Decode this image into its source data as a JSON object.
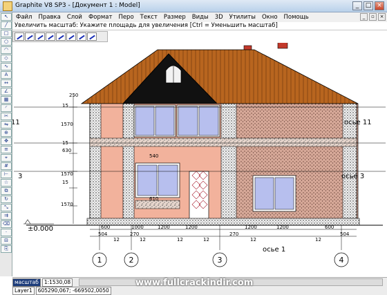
{
  "window": {
    "title": "Graphite V8 SP3 - [Документ 1 : Model]",
    "controls": [
      "_",
      "□",
      "×"
    ]
  },
  "menu": [
    "Файл",
    "Правка",
    "Слой",
    "Формат",
    "Перо",
    "Текст",
    "Размер",
    "Виды",
    "3D",
    "Утилиты",
    "Окно",
    "Помощь"
  ],
  "prompt": "Увеличить масштаб: Укажите площадь для увеличения  [Ctrl = Уменьшить масштаб]",
  "drawing": {
    "left_dims": [
      "250",
      "15",
      "1570",
      "15",
      "630",
      "1570",
      "15",
      "1570"
    ],
    "inner_labels": [
      "540",
      "610"
    ],
    "bottom_dims_row1": [
      "600",
      "1000",
      "1200",
      "1200",
      "1200",
      "1200",
      "600"
    ],
    "bottom_dims_row2": [
      "504",
      "12",
      "270",
      "12",
      "12",
      "12",
      "270",
      "12",
      "12",
      "504"
    ],
    "axes": [
      "1",
      "2",
      "3",
      "4"
    ],
    "axis_labels": {
      "left_11": "11",
      "left_3": "3",
      "right_11": "осье 11",
      "right_3": "осье 3",
      "bottom_1": "осье 1"
    },
    "elevation": "±0.000"
  },
  "status": {
    "field1": "масштаб",
    "field2": "1:1530,08",
    "layer": "Layer1",
    "coords": "605290,067; -669502,0050"
  },
  "watermark": "www.fullcrackindir.com",
  "colors": {
    "roof": "#b8651f",
    "wall_pink": "#f2b29c",
    "granite": "#d8b5a8",
    "window": "#b7bfee"
  }
}
